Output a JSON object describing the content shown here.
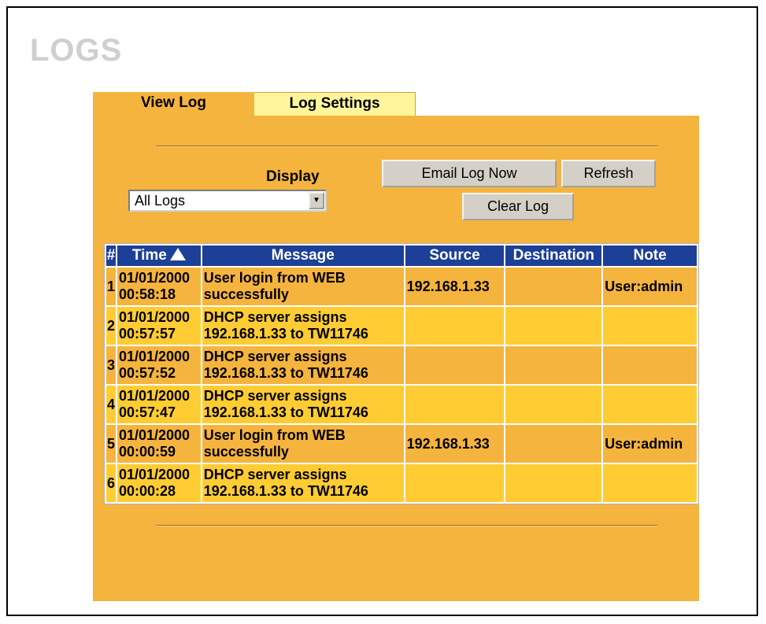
{
  "page": {
    "title": "LOGS"
  },
  "tabs": [
    {
      "label": "View Log",
      "active": true
    },
    {
      "label": "Log Settings",
      "active": false
    }
  ],
  "controls": {
    "display_label": "Display",
    "display_select": "All Logs",
    "email_button": "Email Log Now",
    "refresh_button": "Refresh",
    "clear_button": "Clear Log"
  },
  "table": {
    "headers": {
      "num": "#",
      "time": "Time",
      "message": "Message",
      "source": "Source",
      "destination": "Destination",
      "note": "Note"
    },
    "rows": [
      {
        "num": "1",
        "date": "01/01/2000",
        "time": "00:58:18",
        "msg1": "User login from WEB",
        "msg2": "successfully",
        "source": "192.168.1.33",
        "destination": "",
        "note": "User:admin"
      },
      {
        "num": "2",
        "date": "01/01/2000",
        "time": "00:57:57",
        "msg1": "DHCP server assigns",
        "msg2": "192.168.1.33 to TW11746",
        "source": "",
        "destination": "",
        "note": ""
      },
      {
        "num": "3",
        "date": "01/01/2000",
        "time": "00:57:52",
        "msg1": "DHCP server assigns",
        "msg2": "192.168.1.33 to TW11746",
        "source": "",
        "destination": "",
        "note": ""
      },
      {
        "num": "4",
        "date": "01/01/2000",
        "time": "00:57:47",
        "msg1": "DHCP server assigns",
        "msg2": "192.168.1.33 to TW11746",
        "source": "",
        "destination": "",
        "note": ""
      },
      {
        "num": "5",
        "date": "01/01/2000",
        "time": "00:00:59",
        "msg1": "User login from WEB",
        "msg2": "successfully",
        "source": "192.168.1.33",
        "destination": "",
        "note": "User:admin"
      },
      {
        "num": "6",
        "date": "01/01/2000",
        "time": "00:00:28",
        "msg1": "DHCP server assigns",
        "msg2": "192.168.1.33 to TW11746",
        "source": "",
        "destination": "",
        "note": ""
      }
    ]
  },
  "colors": {
    "panel": "#f5b43e",
    "row_alt": "#ffcc33",
    "header": "#1c3f97",
    "inactive_tab": "#fff59b"
  },
  "icons": {
    "sort": "sort-ascending-arrow-icon",
    "dropdown": "chevron-down-icon"
  }
}
